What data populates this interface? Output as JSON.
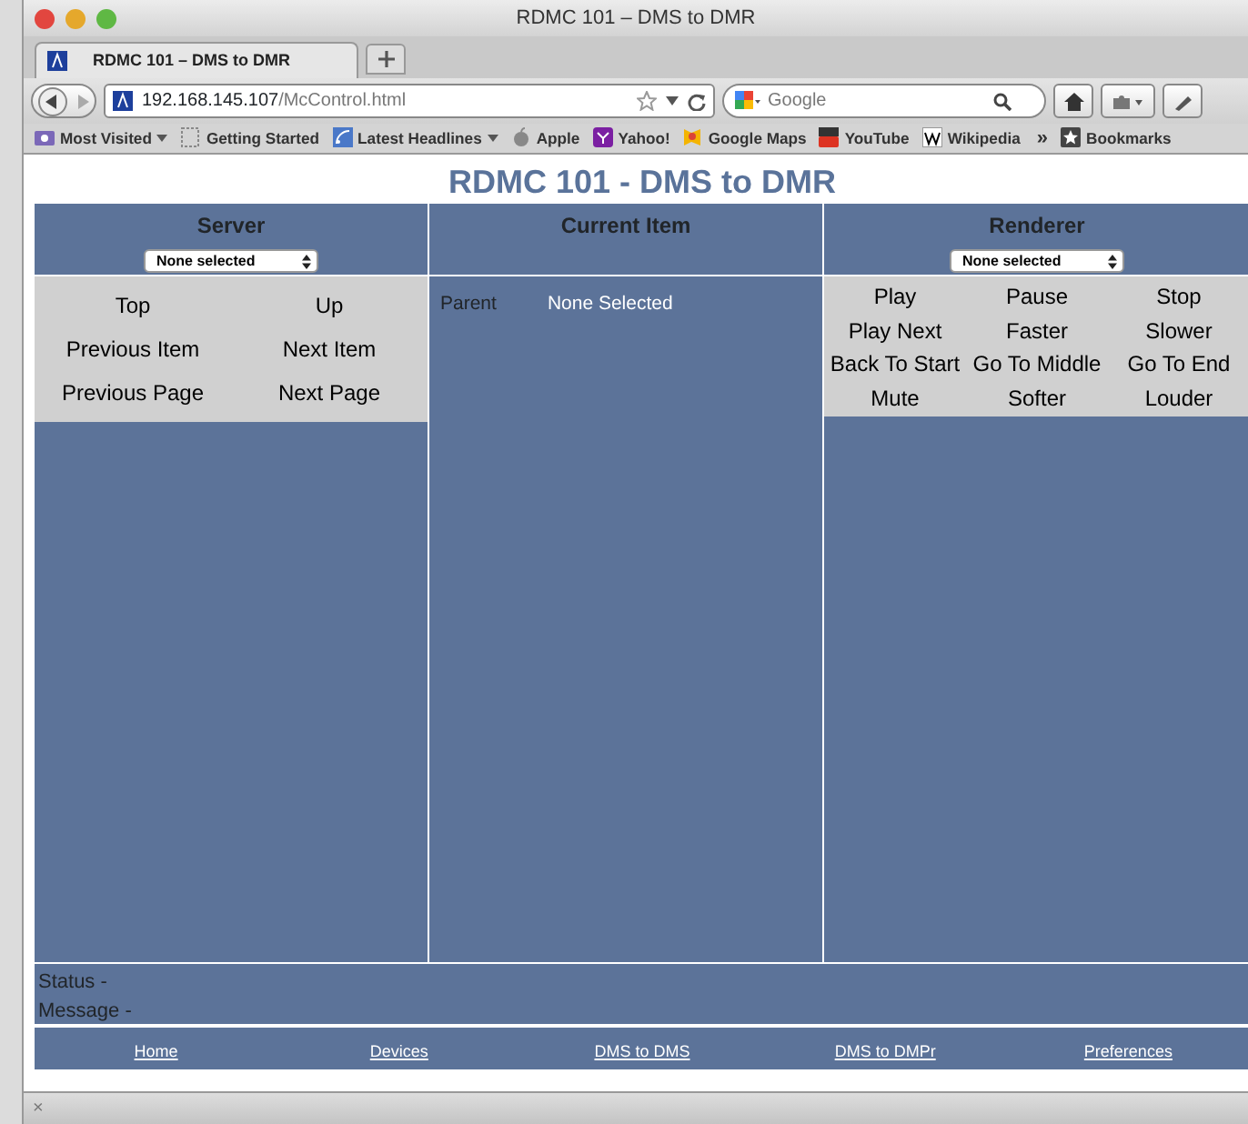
{
  "window": {
    "title": "RDMC 101 – DMS to DMR"
  },
  "tabs": [
    {
      "label": "RDMC 101 – DMS to DMR",
      "selected": true
    }
  ],
  "toolbar": {
    "url_host": "192.168.145.107",
    "url_path": "/McControl.html",
    "search_placeholder": "Google"
  },
  "bookmarks": [
    {
      "label": "Most Visited",
      "kind": "folder",
      "menu": true
    },
    {
      "label": "Getting Started",
      "kind": "page",
      "menu": false
    },
    {
      "label": "Latest Headlines",
      "kind": "feed",
      "menu": true
    },
    {
      "label": "Apple",
      "kind": "apple",
      "menu": false
    },
    {
      "label": "Yahoo!",
      "kind": "yahoo",
      "menu": false
    },
    {
      "label": "Google Maps",
      "kind": "maps",
      "menu": false
    },
    {
      "label": "YouTube",
      "kind": "youtube",
      "menu": false
    },
    {
      "label": "Wikipedia",
      "kind": "wiki",
      "menu": false
    }
  ],
  "bookmarks_overflow": "»",
  "bookmarks_menu": "Bookmarks",
  "page": {
    "title": "RDMC 101 - DMS to DMR",
    "server": {
      "heading": "Server",
      "select": "None selected",
      "buttons": [
        "Top",
        "Up",
        "Previous Item",
        "Next Item",
        "Previous Page",
        "Next Page"
      ]
    },
    "current_item": {
      "heading": "Current Item",
      "rows": [
        {
          "label": "Parent",
          "value": "None Selected"
        }
      ]
    },
    "renderer": {
      "heading": "Renderer",
      "select": "None selected",
      "buttons": [
        "Play",
        "Pause",
        "Stop",
        "Play Next",
        "Faster",
        "Slower",
        "Back To Start",
        "Go To Middle",
        "Go To End",
        "Mute",
        "Softer",
        "Louder"
      ]
    },
    "status_lines": [
      "Status -",
      "Message -"
    ],
    "footer_links": [
      "Home",
      "Devices",
      "DMS to DMS",
      "DMS to DMPr",
      "Preferences"
    ]
  },
  "status_bar": {
    "close": "×"
  }
}
